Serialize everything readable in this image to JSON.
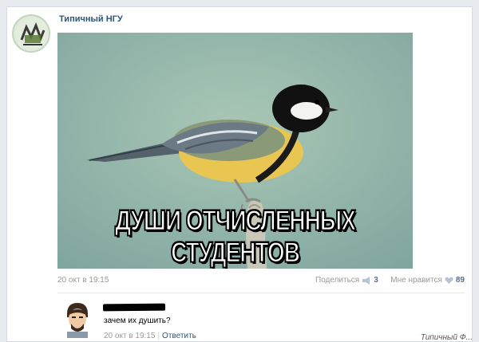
{
  "post": {
    "group_name": "Типичный НГУ",
    "group_avatar_icon": "group-logo-icon",
    "image_caption": "ДУШИ ОТЧИСЛЕННЫХ СТУДЕНТОВ",
    "image_subject": "great-tit-bird-image",
    "date": "20 окт в 19:15",
    "share_label": "Поделиться",
    "share_count": "3",
    "like_label": "Мне нравится",
    "like_count": "89",
    "accent_color": "#2b587a",
    "muted_color": "#999999"
  },
  "comment": {
    "avatar_icon": "user-avatar-icon",
    "text": "зачем их душить?",
    "date": "20 окт в 19:15",
    "separator": "|",
    "reply_label": "Ответить"
  },
  "watermark": {
    "text": "Типичный Ф..."
  }
}
